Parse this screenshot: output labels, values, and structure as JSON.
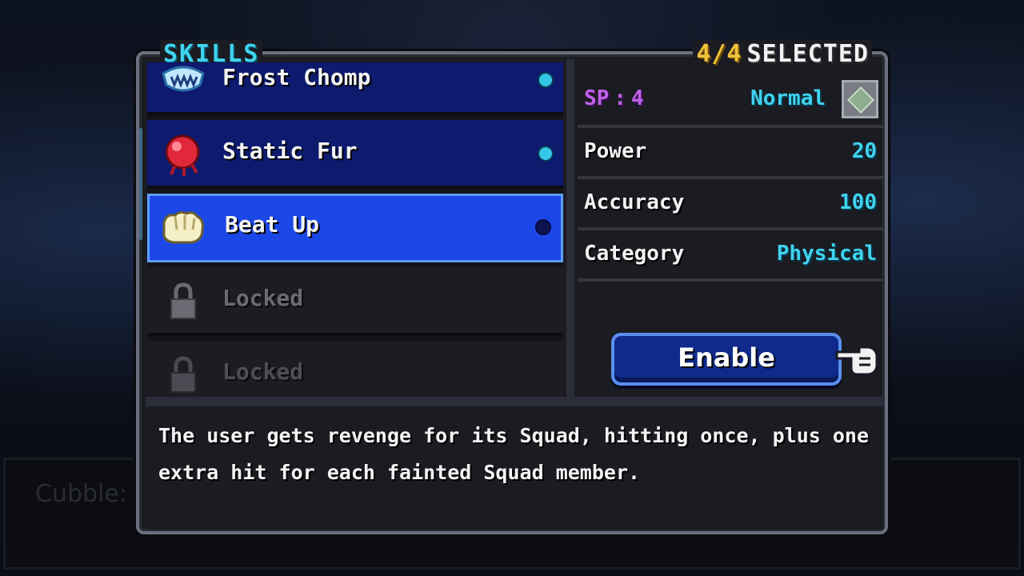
{
  "background": {
    "dialog_speaker": "Cubble:"
  },
  "header": {
    "title": "SKILLS",
    "selected_count": "4/4",
    "selected_word": "SELECTED"
  },
  "skills": [
    {
      "name": "Frost Chomp",
      "state": "enabled",
      "icon": "frost-fangs-icon"
    },
    {
      "name": "Static Fur",
      "state": "enabled",
      "icon": "red-orb-icon"
    },
    {
      "name": "Beat Up",
      "state": "highlighted",
      "icon": "fist-icon"
    },
    {
      "name": "Locked",
      "state": "locked",
      "icon": "lock-icon"
    },
    {
      "name": "Locked",
      "state": "locked",
      "icon": "lock-icon"
    }
  ],
  "stats": {
    "sp_label": "SP",
    "sp_separator": ":",
    "sp_value": "4",
    "type_value": "Normal",
    "type_icon": "normal-type-gem-icon",
    "power_label": "Power",
    "power_value": "20",
    "accuracy_label": "Accuracy",
    "accuracy_value": "100",
    "category_label": "Category",
    "category_value": "Physical"
  },
  "actions": {
    "enable_label": "Enable"
  },
  "description": "The user gets revenge for its Squad, hitting once, plus one extra hit for each fainted Squad member.",
  "colors": {
    "accent_cyan": "#3fd3ef",
    "accent_gold": "#f2c23a",
    "sp_purple": "#c061e8",
    "selected_row_blue": "#1b47e6",
    "enabled_row_navy": "#0d1a6e"
  }
}
